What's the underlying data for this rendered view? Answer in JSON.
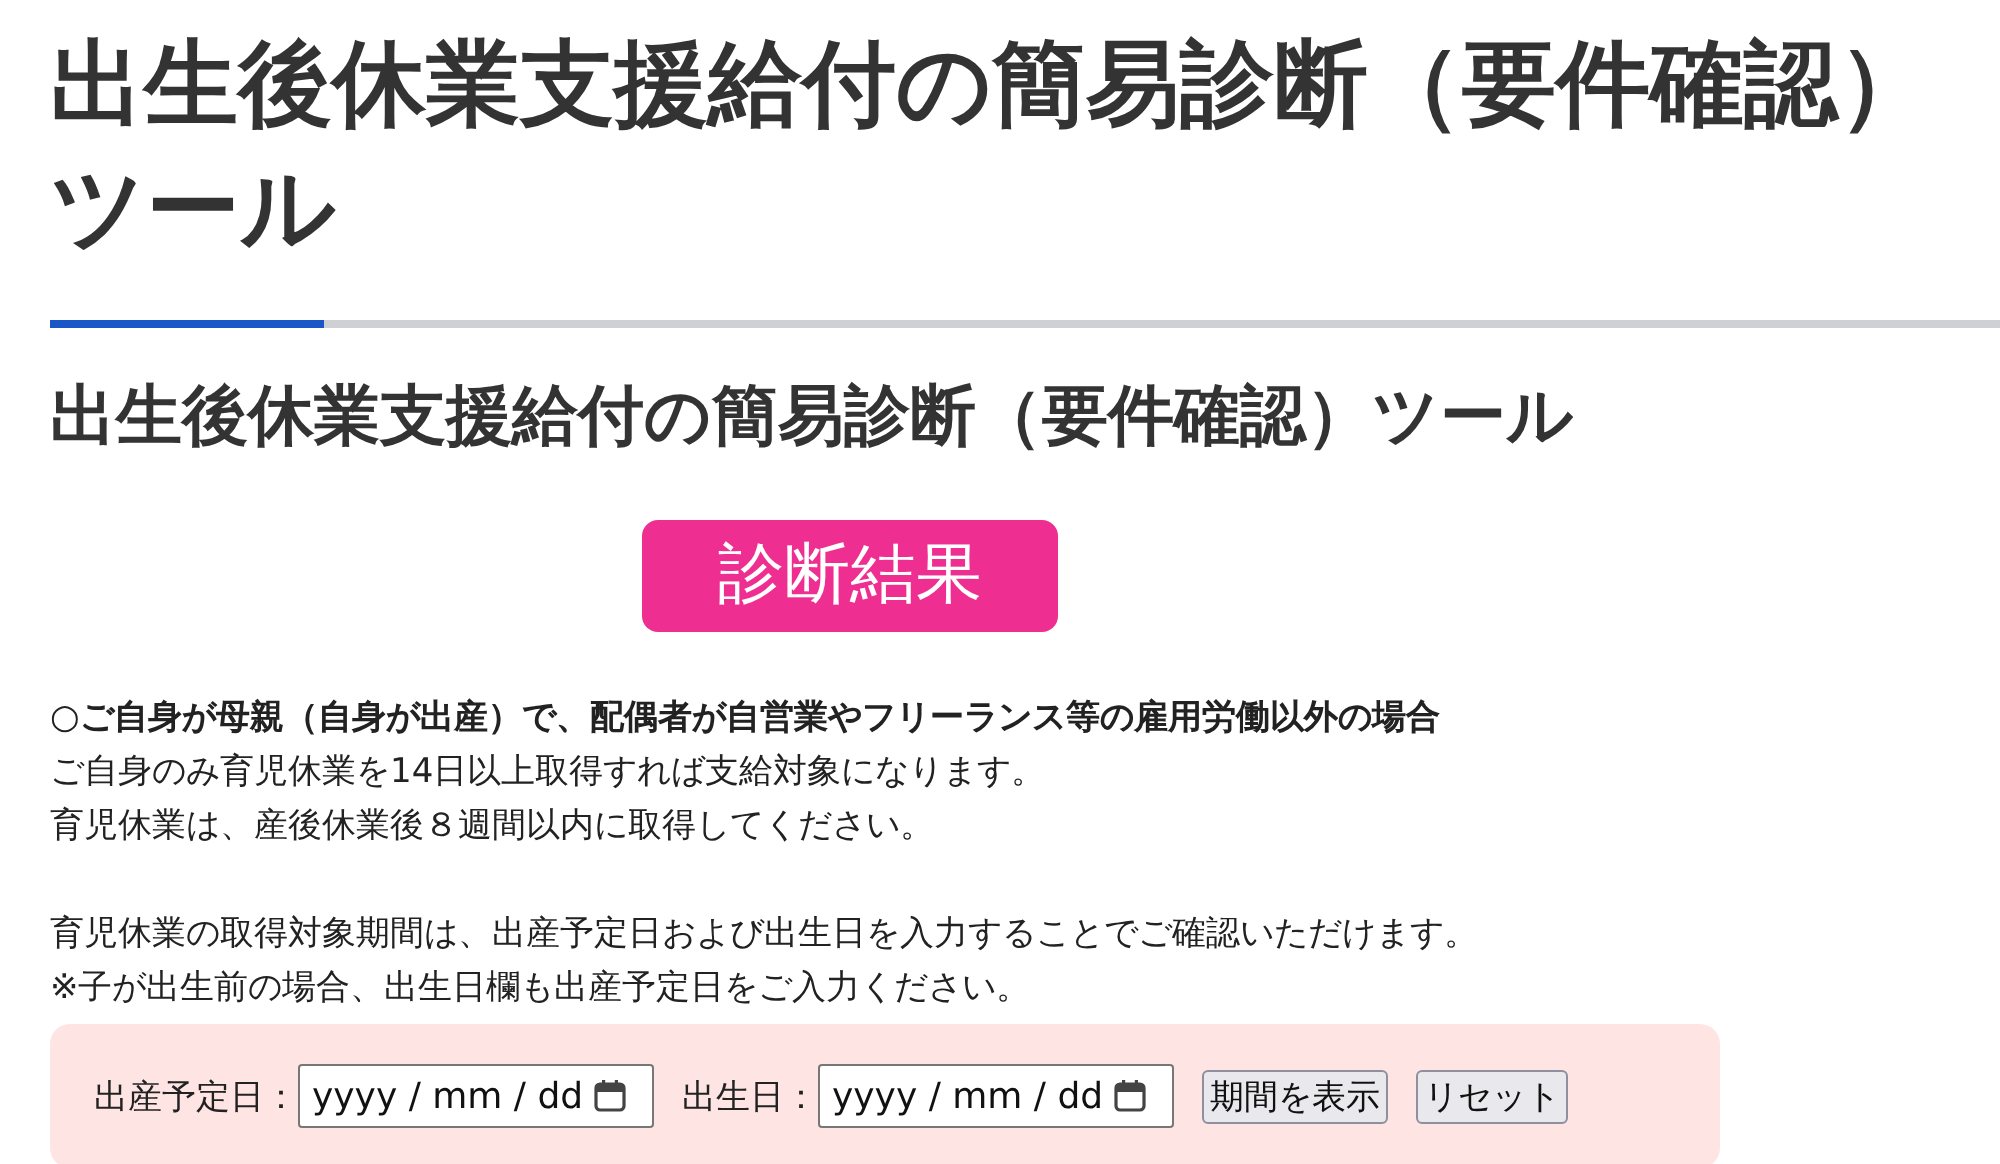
{
  "page_title": "出生後休業支援給付の簡易診断（要件確認）ツール",
  "section_title": "出生後休業支援給付の簡易診断（要件確認）ツール",
  "result_badge": "診断結果",
  "case_heading": "○ご自身が母親（自身が出産）で、配偶者が自営業やフリーランス等の雇用労働以外の場合",
  "paragraphs": [
    [
      "ご自身のみ育児休業を14日以上取得すれば支給対象になります。",
      "育児休業は、産後休業後８週間以内に取得してください。"
    ],
    [
      "育児休業の取得対象期間は、出産予定日および出生日を入力することでご確認いただけます。",
      "※子が出生前の場合、出生日欄も出産予定日をご入力ください。"
    ]
  ],
  "form": {
    "fields": [
      {
        "label": "出産予定日：",
        "placeholder": "yyyy / mm / dd"
      },
      {
        "label": "出生日：",
        "placeholder": "yyyy / mm / dd"
      }
    ],
    "buttons": [
      "期間を表示",
      "リセット"
    ]
  }
}
